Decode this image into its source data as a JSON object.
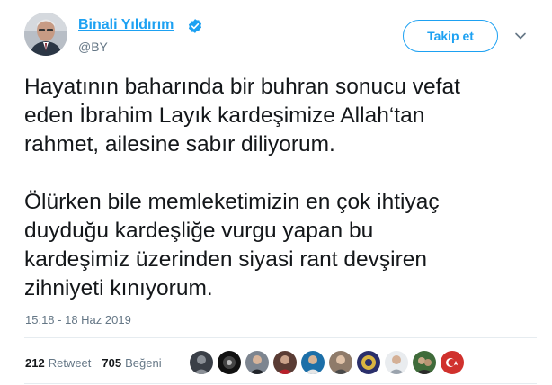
{
  "author": {
    "name": "Binali Yıldırım",
    "handle": "@BY"
  },
  "follow_button": {
    "label": "Takip et"
  },
  "tweet": {
    "paragraph1": "Hayatının baharında bir buhran sonucu vefat\neden İbrahim Layık kardeşimize Allah‘tan\nrahmet, ailesine sabır diliyorum.",
    "paragraph2": "Ölürken bile memleketimizin en çok ihtiyaç\nduyduğu kardeşliğe vurgu yapan bu\nkardeşimiz üzerinden siyasi rant devşiren\nzihniyeti kınıyorum.",
    "timestamp": "15:18 - 18 Haz 2019"
  },
  "stats": {
    "retweet_count": "212",
    "retweet_label": "Retweet",
    "like_count": "705",
    "like_label": "Beğeni"
  },
  "colors": {
    "accent": "#1da1f2",
    "secondary_text": "#657786",
    "divider": "#e6ecf0"
  },
  "icons": [
    "verified-badge-icon",
    "chevron-down-icon"
  ]
}
